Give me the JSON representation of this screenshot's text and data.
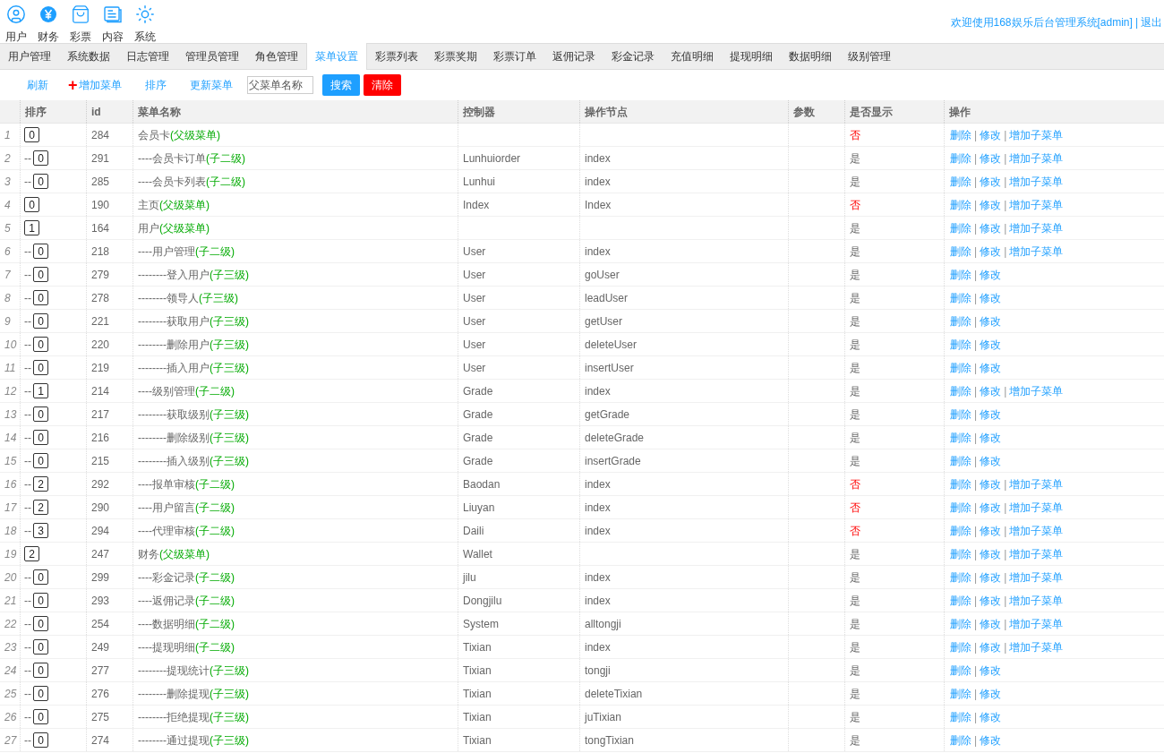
{
  "top_nav": [
    {
      "label": "用户",
      "kind": "user"
    },
    {
      "label": "财务",
      "kind": "yen"
    },
    {
      "label": "彩票",
      "kind": "bag"
    },
    {
      "label": "内容",
      "kind": "doc"
    },
    {
      "label": "系统",
      "kind": "sun"
    }
  ],
  "welcome": "欢迎使用168娱乐后台管理系统[admin]",
  "logout_separator": "|",
  "logout": "退出",
  "tabs": [
    {
      "label": "用户管理",
      "selected": false
    },
    {
      "label": "系统数据",
      "selected": false
    },
    {
      "label": "日志管理",
      "selected": false
    },
    {
      "label": "管理员管理",
      "selected": false
    },
    {
      "label": "角色管理",
      "selected": false
    },
    {
      "label": "菜单设置",
      "selected": true
    },
    {
      "label": "彩票列表",
      "selected": false
    },
    {
      "label": "彩票奖期",
      "selected": false
    },
    {
      "label": "彩票订单",
      "selected": false
    },
    {
      "label": "返佣记录",
      "selected": false
    },
    {
      "label": "彩金记录",
      "selected": false
    },
    {
      "label": "充值明细",
      "selected": false
    },
    {
      "label": "提现明细",
      "selected": false
    },
    {
      "label": "数据明细",
      "selected": false
    },
    {
      "label": "级别管理",
      "selected": false
    }
  ],
  "toolbar": {
    "refresh": "刷新",
    "add_icon": "+",
    "add": "增加菜单",
    "sort": "排序",
    "update": "更新菜单",
    "search": {
      "placeholder": "父菜单名称"
    },
    "search_button": "搜索",
    "clear_button": "清除"
  },
  "table": {
    "columns": [
      "排序",
      "id",
      "菜单名称",
      "控制器",
      "操作节点",
      "参数",
      "是否显示",
      "操作"
    ],
    "action_separator": "|",
    "rows": [
      {
        "n": "1",
        "prefix": "",
        "sort": "0",
        "id": "284",
        "name": "会员卡",
        "tag": "(父级菜单)",
        "controller": "",
        "node": "",
        "show": "否",
        "visible": false,
        "actions": [
          "删除",
          "修改",
          "增加子菜单"
        ]
      },
      {
        "n": "2",
        "prefix": "--",
        "sort": "0",
        "id": "291",
        "name": "----会员卡订单",
        "tag": "(子二级)",
        "controller": "Lunhuiorder",
        "node": "index",
        "show": "是",
        "visible": true,
        "actions": [
          "删除",
          "修改",
          "增加子菜单"
        ]
      },
      {
        "n": "3",
        "prefix": "--",
        "sort": "0",
        "id": "285",
        "name": "----会员卡列表",
        "tag": "(子二级)",
        "controller": "Lunhui",
        "node": "index",
        "show": "是",
        "visible": true,
        "actions": [
          "删除",
          "修改",
          "增加子菜单"
        ]
      },
      {
        "n": "4",
        "prefix": "",
        "sort": "0",
        "id": "190",
        "name": "主页",
        "tag": "(父级菜单)",
        "controller": "Index",
        "node": "Index",
        "show": "否",
        "visible": false,
        "actions": [
          "删除",
          "修改",
          "增加子菜单"
        ]
      },
      {
        "n": "5",
        "prefix": "",
        "sort": "1",
        "id": "164",
        "name": "用户",
        "tag": "(父级菜单)",
        "controller": "",
        "node": "",
        "show": "是",
        "visible": true,
        "actions": [
          "删除",
          "修改",
          "增加子菜单"
        ]
      },
      {
        "n": "6",
        "prefix": "--",
        "sort": "0",
        "id": "218",
        "name": "----用户管理",
        "tag": "(子二级)",
        "controller": "User",
        "node": "index",
        "show": "是",
        "visible": true,
        "actions": [
          "删除",
          "修改",
          "增加子菜单"
        ]
      },
      {
        "n": "7",
        "prefix": "--",
        "sort": "0",
        "id": "279",
        "name": "--------登入用户",
        "tag": "(子三级)",
        "controller": "User",
        "node": "goUser",
        "show": "是",
        "visible": true,
        "actions": [
          "删除",
          "修改"
        ]
      },
      {
        "n": "8",
        "prefix": "--",
        "sort": "0",
        "id": "278",
        "name": "--------领导人",
        "tag": "(子三级)",
        "controller": "User",
        "node": "leadUser",
        "show": "是",
        "visible": true,
        "actions": [
          "删除",
          "修改"
        ]
      },
      {
        "n": "9",
        "prefix": "--",
        "sort": "0",
        "id": "221",
        "name": "--------获取用户",
        "tag": "(子三级)",
        "controller": "User",
        "node": "getUser",
        "show": "是",
        "visible": true,
        "actions": [
          "删除",
          "修改"
        ]
      },
      {
        "n": "10",
        "prefix": "--",
        "sort": "0",
        "id": "220",
        "name": "--------删除用户",
        "tag": "(子三级)",
        "controller": "User",
        "node": "deleteUser",
        "show": "是",
        "visible": true,
        "actions": [
          "删除",
          "修改"
        ]
      },
      {
        "n": "11",
        "prefix": "--",
        "sort": "0",
        "id": "219",
        "name": "--------插入用户",
        "tag": "(子三级)",
        "controller": "User",
        "node": "insertUser",
        "show": "是",
        "visible": true,
        "actions": [
          "删除",
          "修改"
        ]
      },
      {
        "n": "12",
        "prefix": "--",
        "sort": "1",
        "id": "214",
        "name": "----级别管理",
        "tag": "(子二级)",
        "controller": "Grade",
        "node": "index",
        "show": "是",
        "visible": true,
        "actions": [
          "删除",
          "修改",
          "增加子菜单"
        ]
      },
      {
        "n": "13",
        "prefix": "--",
        "sort": "0",
        "id": "217",
        "name": "--------获取级别",
        "tag": "(子三级)",
        "controller": "Grade",
        "node": "getGrade",
        "show": "是",
        "visible": true,
        "actions": [
          "删除",
          "修改"
        ]
      },
      {
        "n": "14",
        "prefix": "--",
        "sort": "0",
        "id": "216",
        "name": "--------删除级别",
        "tag": "(子三级)",
        "controller": "Grade",
        "node": "deleteGrade",
        "show": "是",
        "visible": true,
        "actions": [
          "删除",
          "修改"
        ]
      },
      {
        "n": "15",
        "prefix": "--",
        "sort": "0",
        "id": "215",
        "name": "--------插入级别",
        "tag": "(子三级)",
        "controller": "Grade",
        "node": "insertGrade",
        "show": "是",
        "visible": true,
        "actions": [
          "删除",
          "修改"
        ]
      },
      {
        "n": "16",
        "prefix": "--",
        "sort": "2",
        "id": "292",
        "name": "----报单审核",
        "tag": "(子二级)",
        "controller": "Baodan",
        "node": "index",
        "show": "否",
        "visible": false,
        "actions": [
          "删除",
          "修改",
          "增加子菜单"
        ]
      },
      {
        "n": "17",
        "prefix": "--",
        "sort": "2",
        "id": "290",
        "name": "----用户留言",
        "tag": "(子二级)",
        "controller": "Liuyan",
        "node": "index",
        "show": "否",
        "visible": false,
        "actions": [
          "删除",
          "修改",
          "增加子菜单"
        ]
      },
      {
        "n": "18",
        "prefix": "--",
        "sort": "3",
        "id": "294",
        "name": "----代理审核",
        "tag": "(子二级)",
        "controller": "Daili",
        "node": "index",
        "show": "否",
        "visible": false,
        "actions": [
          "删除",
          "修改",
          "增加子菜单"
        ]
      },
      {
        "n": "19",
        "prefix": "",
        "sort": "2",
        "id": "247",
        "name": "财务",
        "tag": "(父级菜单)",
        "controller": "Wallet",
        "node": "",
        "show": "是",
        "visible": true,
        "actions": [
          "删除",
          "修改",
          "增加子菜单"
        ]
      },
      {
        "n": "20",
        "prefix": "--",
        "sort": "0",
        "id": "299",
        "name": "----彩金记录",
        "tag": "(子二级)",
        "controller": "jilu",
        "node": "index",
        "show": "是",
        "visible": true,
        "actions": [
          "删除",
          "修改",
          "增加子菜单"
        ]
      },
      {
        "n": "21",
        "prefix": "--",
        "sort": "0",
        "id": "293",
        "name": "----返佣记录",
        "tag": "(子二级)",
        "controller": "Dongjilu",
        "node": "index",
        "show": "是",
        "visible": true,
        "actions": [
          "删除",
          "修改",
          "增加子菜单"
        ]
      },
      {
        "n": "22",
        "prefix": "--",
        "sort": "0",
        "id": "254",
        "name": "----数据明细",
        "tag": "(子二级)",
        "controller": "System",
        "node": "alltongji",
        "show": "是",
        "visible": true,
        "actions": [
          "删除",
          "修改",
          "增加子菜单"
        ]
      },
      {
        "n": "23",
        "prefix": "--",
        "sort": "0",
        "id": "249",
        "name": "----提现明细",
        "tag": "(子二级)",
        "controller": "Tixian",
        "node": "index",
        "show": "是",
        "visible": true,
        "actions": [
          "删除",
          "修改",
          "增加子菜单"
        ]
      },
      {
        "n": "24",
        "prefix": "--",
        "sort": "0",
        "id": "277",
        "name": "--------提现统计",
        "tag": "(子三级)",
        "controller": "Tixian",
        "node": "tongji",
        "show": "是",
        "visible": true,
        "actions": [
          "删除",
          "修改"
        ]
      },
      {
        "n": "25",
        "prefix": "--",
        "sort": "0",
        "id": "276",
        "name": "--------删除提现",
        "tag": "(子三级)",
        "controller": "Tixian",
        "node": "deleteTixian",
        "show": "是",
        "visible": true,
        "actions": [
          "删除",
          "修改"
        ]
      },
      {
        "n": "26",
        "prefix": "--",
        "sort": "0",
        "id": "275",
        "name": "--------拒绝提现",
        "tag": "(子三级)",
        "controller": "Tixian",
        "node": "juTixian",
        "show": "是",
        "visible": true,
        "actions": [
          "删除",
          "修改"
        ]
      },
      {
        "n": "27",
        "prefix": "--",
        "sort": "0",
        "id": "274",
        "name": "--------通过提现",
        "tag": "(子三级)",
        "controller": "Tixian",
        "node": "tongTixian",
        "show": "是",
        "visible": true,
        "actions": [
          "删除",
          "修改"
        ]
      }
    ]
  }
}
